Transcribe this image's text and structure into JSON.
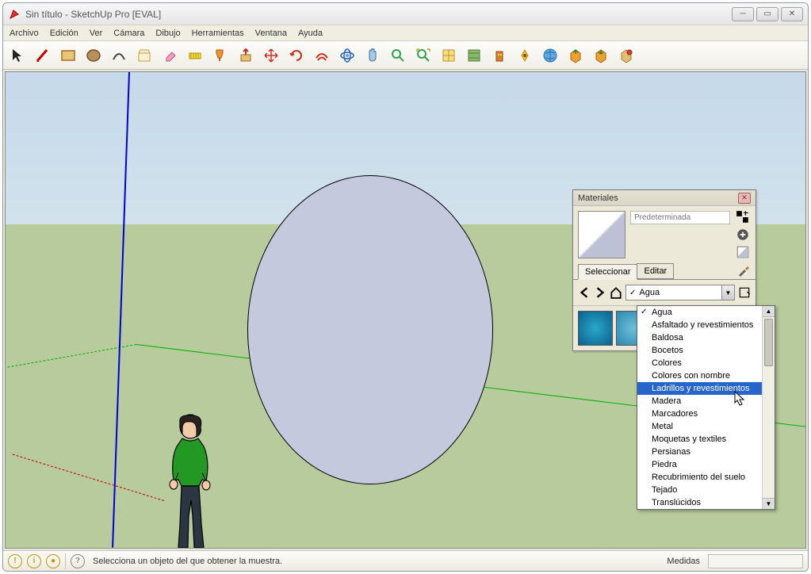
{
  "window": {
    "title": "Sin título - SketchUp Pro [EVAL]"
  },
  "menu": {
    "items": [
      "Archivo",
      "Edición",
      "Ver",
      "Cámara",
      "Dibujo",
      "Herramientas",
      "Ventana",
      "Ayuda"
    ]
  },
  "panel": {
    "title": "Materiales",
    "material_name": "Predeterminada",
    "tabs": {
      "select": "Seleccionar",
      "edit": "Editar"
    },
    "dropdown_value": "Agua",
    "dropdown_items": [
      "Agua",
      "Asfaltado y revestimientos",
      "Baldosa",
      "Bocetos",
      "Colores",
      "Colores con nombre",
      "Ladrillos y revestimientos",
      "Madera",
      "Marcadores",
      "Metal",
      "Moquetas y textiles",
      "Persianas",
      "Piedra",
      "Recubrimiento del suelo",
      "Tejado",
      "Translúcidos"
    ],
    "highlighted_index": 6
  },
  "status": {
    "hint": "Selecciona un objeto del que obtener la muestra.",
    "measures_label": "Medidas"
  }
}
